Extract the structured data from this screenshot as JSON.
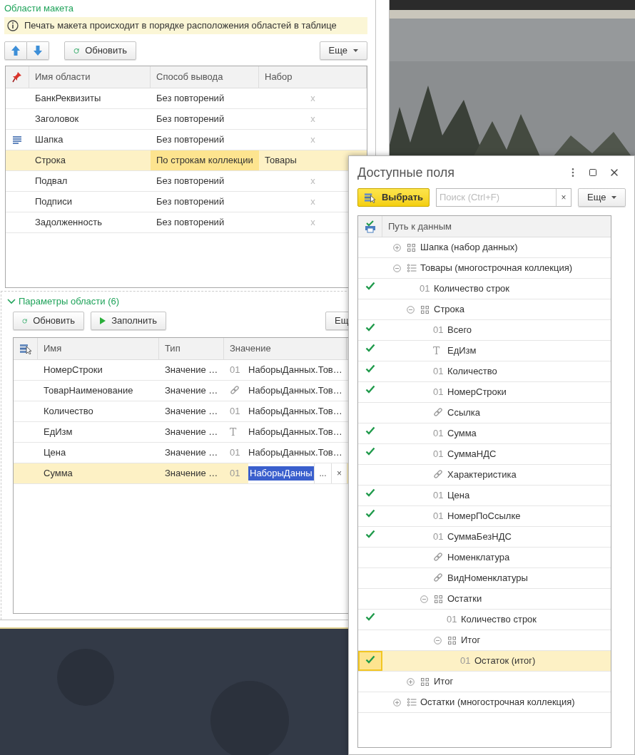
{
  "areas_section": {
    "title": "Области макета",
    "info": "Печать макета происходит в порядке расположения областей в таблице",
    "toolbar": {
      "refresh": "Обновить",
      "more": "Еще"
    },
    "table": {
      "columns": [
        "Имя области",
        "Способ вывода",
        "Набор"
      ],
      "rows": [
        {
          "name": "БанкРеквизиты",
          "mode": "Без повторений",
          "set": "x",
          "set_empty": true,
          "marked": false,
          "selected": false
        },
        {
          "name": "Заголовок",
          "mode": "Без повторений",
          "set": "x",
          "set_empty": true,
          "marked": false,
          "selected": false
        },
        {
          "name": "Шапка",
          "mode": "Без повторений",
          "set": "x",
          "set_empty": true,
          "marked": true,
          "selected": false
        },
        {
          "name": "Строка",
          "mode": "По строкам коллекции",
          "set": "Товары",
          "set_empty": false,
          "marked": false,
          "selected": true
        },
        {
          "name": "Подвал",
          "mode": "Без повторений",
          "set": "x",
          "set_empty": true,
          "marked": false,
          "selected": false
        },
        {
          "name": "Подписи",
          "mode": "Без повторений",
          "set": "x",
          "set_empty": true,
          "marked": false,
          "selected": false
        },
        {
          "name": "Задолженность",
          "mode": "Без повторений",
          "set": "x",
          "set_empty": true,
          "marked": false,
          "selected": false
        }
      ]
    }
  },
  "params_section": {
    "title": "Параметры области (6)",
    "expanded": true,
    "toolbar": {
      "refresh": "Обновить",
      "fill": "Заполнить",
      "more": "Ещ"
    },
    "table": {
      "columns": [
        "Имя",
        "Тип",
        "Значение"
      ],
      "rows": [
        {
          "name": "НомерСтроки",
          "type": "Значение …",
          "kind": "number",
          "glyph": "01",
          "value": "НаборыДанных.Тов…",
          "selected": false
        },
        {
          "name": "ТоварНаименование",
          "type": "Значение …",
          "kind": "link",
          "value": "НаборыДанных.Тов…",
          "selected": false
        },
        {
          "name": "Количество",
          "type": "Значение …",
          "kind": "number",
          "glyph": "01",
          "value": "НаборыДанных.Тов…",
          "selected": false
        },
        {
          "name": "ЕдИзм",
          "type": "Значение …",
          "kind": "string",
          "glyph": "T",
          "value": "НаборыДанных.Тов…",
          "selected": false
        },
        {
          "name": "Цена",
          "type": "Значение …",
          "kind": "number",
          "glyph": "01",
          "value": "НаборыДанных.Тов…",
          "selected": false
        },
        {
          "name": "Сумма",
          "type": "Значение …",
          "kind": "number",
          "glyph": "01",
          "value": "НаборыДанны",
          "selected": true,
          "choice_button": "...",
          "clear_button": "×"
        }
      ]
    }
  },
  "dialog": {
    "title": "Доступные поля",
    "toolbar": {
      "select": "Выбрать",
      "search_placeholder": "Поиск (Ctrl+F)",
      "clear": "×",
      "more": "Еще"
    },
    "tree": {
      "column": "Путь к данным",
      "items": [
        {
          "label": "Шапка (набор данных)",
          "kind": "dataset",
          "expanded": false,
          "checked": false,
          "selected": false
        },
        {
          "label": "Товары (многострочная коллекция)",
          "kind": "collection",
          "expanded": true,
          "checked": false,
          "selected": false,
          "children": [
            {
              "label": "Количество строк",
              "kind": "number",
              "glyph": "01",
              "checked": true,
              "selected": false
            },
            {
              "label": "Строка",
              "kind": "dataset",
              "expanded": true,
              "checked": false,
              "selected": false,
              "children": [
                {
                  "label": "Всего",
                  "kind": "number",
                  "glyph": "01",
                  "checked": true,
                  "selected": false
                },
                {
                  "label": "ЕдИзм",
                  "kind": "string",
                  "glyph": "T",
                  "checked": true,
                  "selected": false
                },
                {
                  "label": "Количество",
                  "kind": "number",
                  "glyph": "01",
                  "checked": true,
                  "selected": false
                },
                {
                  "label": "НомерСтроки",
                  "kind": "number",
                  "glyph": "01",
                  "checked": true,
                  "selected": false
                },
                {
                  "label": "Ссылка",
                  "kind": "link",
                  "checked": false,
                  "selected": false
                },
                {
                  "label": "Сумма",
                  "kind": "number",
                  "glyph": "01",
                  "checked": true,
                  "selected": false
                },
                {
                  "label": "СуммаНДС",
                  "kind": "number",
                  "glyph": "01",
                  "checked": true,
                  "selected": false
                },
                {
                  "label": "Характеристика",
                  "kind": "link",
                  "checked": false,
                  "selected": false
                },
                {
                  "label": "Цена",
                  "kind": "number",
                  "glyph": "01",
                  "checked": true,
                  "selected": false
                },
                {
                  "label": "НомерПоСсылке",
                  "kind": "number",
                  "glyph": "01",
                  "checked": true,
                  "selected": false
                },
                {
                  "label": "СуммаБезНДС",
                  "kind": "number",
                  "glyph": "01",
                  "checked": true,
                  "selected": false
                },
                {
                  "label": "Номенклатура",
                  "kind": "link",
                  "checked": false,
                  "selected": false
                },
                {
                  "label": "ВидНоменклатуры",
                  "kind": "link",
                  "checked": false,
                  "selected": false
                },
                {
                  "label": "Остатки",
                  "kind": "dataset",
                  "expanded": true,
                  "checked": false,
                  "selected": false,
                  "children": [
                    {
                      "label": "Количество строк",
                      "kind": "number",
                      "glyph": "01",
                      "checked": true,
                      "selected": false
                    },
                    {
                      "label": "Итог",
                      "kind": "dataset",
                      "expanded": true,
                      "checked": false,
                      "selected": false,
                      "children": [
                        {
                          "label": "Остаток (итог)",
                          "kind": "number",
                          "glyph": "01",
                          "checked": true,
                          "selected": true
                        }
                      ]
                    }
                  ]
                }
              ]
            },
            {
              "label": "Итог",
              "kind": "dataset",
              "expanded": false,
              "checked": false,
              "selected": false
            }
          ]
        },
        {
          "label": "Остатки (многострочная коллекция)",
          "kind": "collection",
          "expanded": false,
          "checked": false,
          "selected": false
        }
      ]
    }
  }
}
